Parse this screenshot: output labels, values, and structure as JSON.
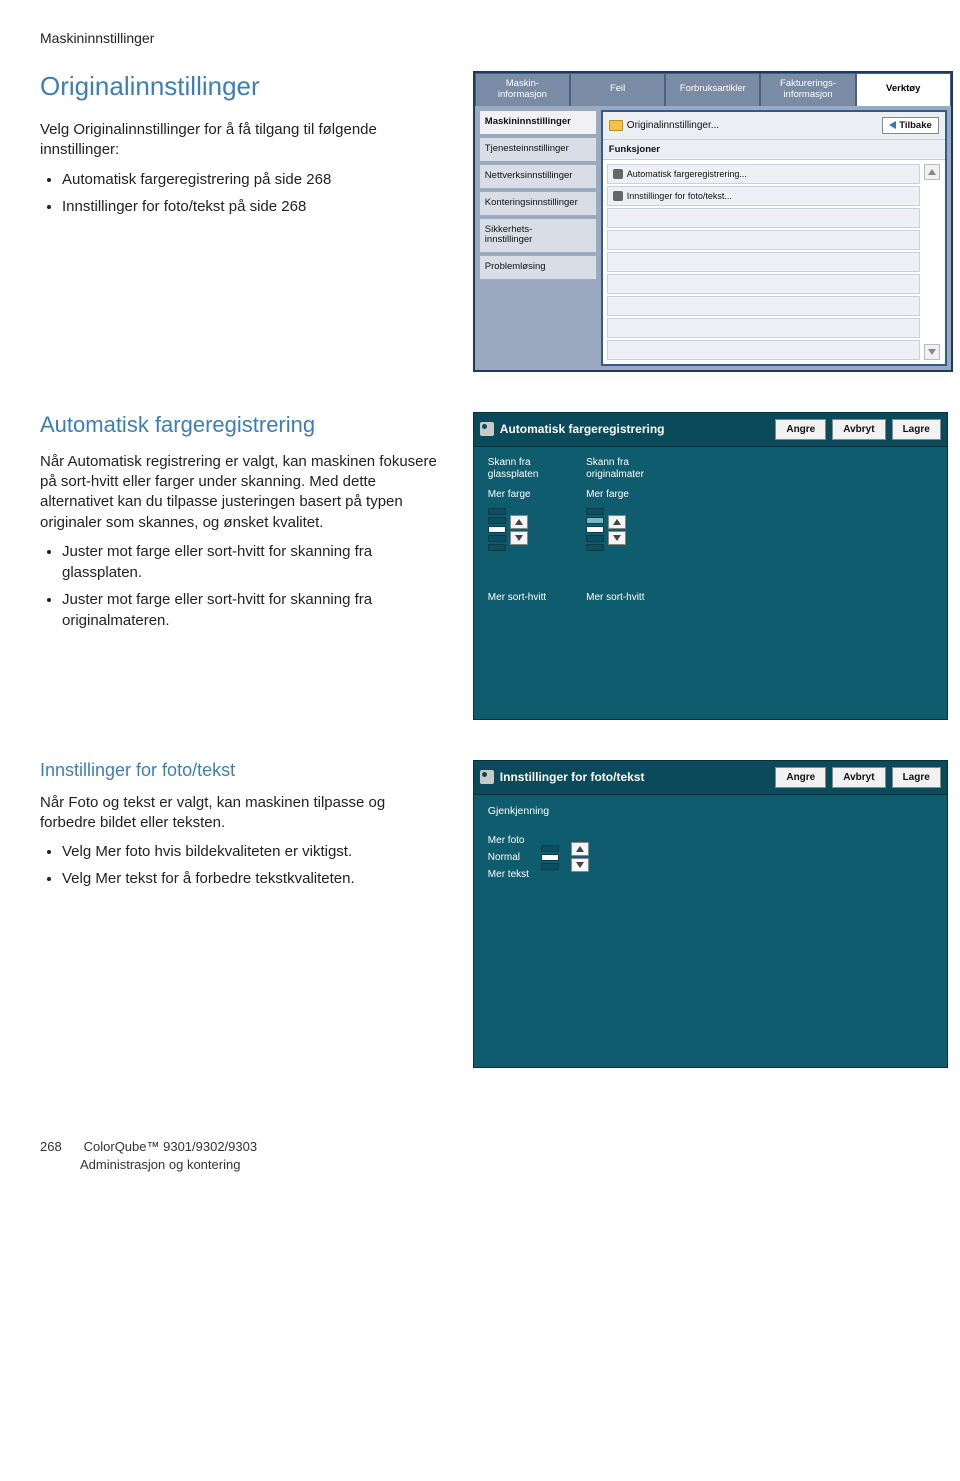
{
  "header_crumb": "Maskininnstillinger",
  "section_title": "Originalinnstillinger",
  "intro": "Velg Originalinnstillinger for å få tilgang til følgende innstillinger:",
  "intro_items": [
    "Automatisk fargeregistrering på side 268",
    "Innstillinger for foto/tekst på side 268"
  ],
  "auto_color": {
    "heading": "Automatisk fargeregistrering",
    "para": "Når Automatisk registrering er valgt, kan maskinen fokusere på sort-hvitt eller farger under skanning. Med dette alternativet kan du tilpasse justeringen basert på typen originaler som skannes, og ønsket kvalitet.",
    "bullets": [
      "Juster mot farge eller sort-hvitt for skanning fra glassplaten.",
      "Juster mot farge eller sort-hvitt for skanning fra originalmateren."
    ]
  },
  "foto_tekst": {
    "heading": "Innstillinger for foto/tekst",
    "para": "Når Foto og tekst er valgt, kan maskinen tilpasse og forbedre bildet eller teksten.",
    "bullets": [
      "Velg Mer foto hvis bildekvaliteten er viktigst.",
      "Velg Mer tekst for å forbedre tekstkvaliteten."
    ]
  },
  "shot1": {
    "tabs": [
      "Maskin-\ninformasjon",
      "Feil",
      "Forbruksartikler",
      "Fakturerings-\ninformasjon",
      "Verktøy"
    ],
    "sidenav": [
      "Maskininnstillinger",
      "Tjenesteinnstillinger",
      "Nettverksinnstillinger",
      "Konteringsinnstillinger",
      "Sikkerhets-\ninnstillinger",
      "Problemløsing"
    ],
    "crumb": "Originalinnstillinger...",
    "back": "Tilbake",
    "subhead": "Funksjoner",
    "items": [
      "Automatisk fargeregistrering...",
      "Innstillinger for foto/tekst..."
    ]
  },
  "shot2": {
    "title": "Automatisk fargeregistrering",
    "btn_undo": "Angre",
    "btn_cancel": "Avbryt",
    "btn_save": "Lagre",
    "col1_top": "Skann fra\nglassplaten",
    "col2_top": "Skann fra\noriginalmater",
    "mid": "Mer farge",
    "bot": "Mer sort-hvitt"
  },
  "shot3": {
    "title": "Innstillinger for foto/tekst",
    "btn_undo": "Angre",
    "btn_cancel": "Avbryt",
    "btn_save": "Lagre",
    "recog": "Gjenkjenning",
    "labels": [
      "Mer foto",
      "Normal",
      "Mer tekst"
    ]
  },
  "footer": {
    "page_num": "268",
    "product": "ColorQube™ 9301/9302/9303",
    "line2": "Administrasjon og kontering"
  }
}
